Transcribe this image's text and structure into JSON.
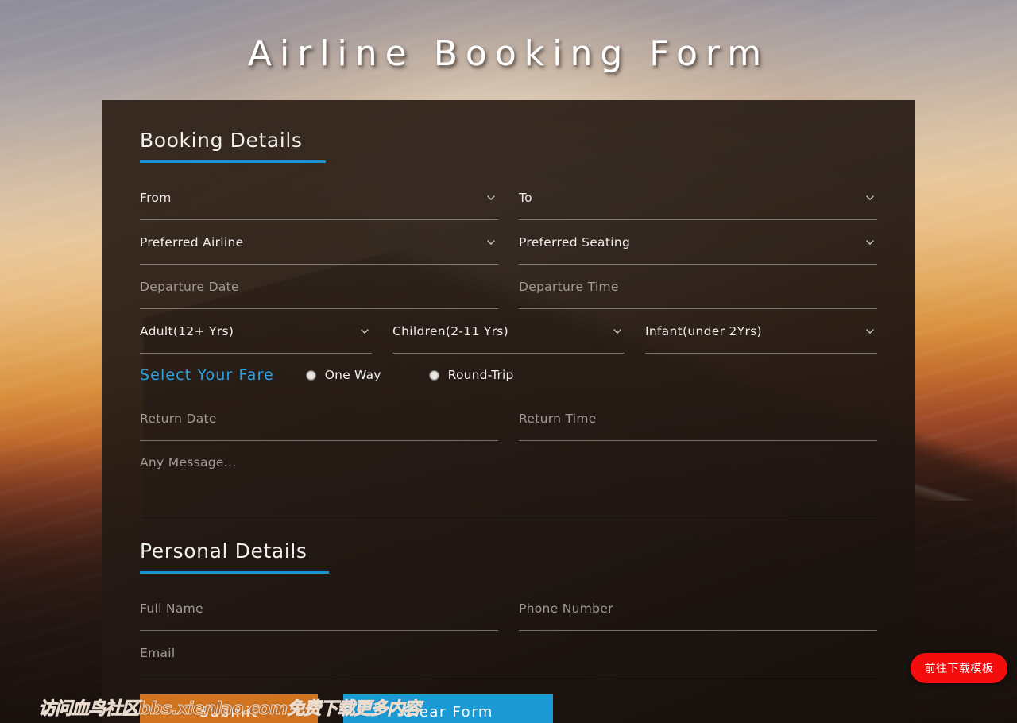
{
  "page": {
    "title": "Airline Booking Form"
  },
  "booking": {
    "heading": "Booking Details",
    "from_label": "From",
    "to_label": "To",
    "airline_label": "Preferred Airline",
    "seating_label": "Preferred Seating",
    "departure_date_placeholder": "Departure Date",
    "departure_time_placeholder": "Departure Time",
    "adult_label": "Adult(12+ Yrs)",
    "children_label": "Children(2-11 Yrs)",
    "infant_label": "Infant(under 2Yrs)",
    "fare": {
      "title": "Select Your Fare",
      "options": [
        {
          "label": "One Way",
          "selected": false
        },
        {
          "label": "Round-Trip",
          "selected": false
        }
      ]
    },
    "return_date_placeholder": "Return Date",
    "return_time_placeholder": "Return Time",
    "message_placeholder": "Any Message..."
  },
  "personal": {
    "heading": "Personal Details",
    "full_name_placeholder": "Full Name",
    "phone_placeholder": "Phone Number",
    "email_placeholder": "Email"
  },
  "actions": {
    "submit_label": "Submit",
    "clear_label": "Clear Form"
  },
  "overlays": {
    "watermark_text": "访问血鸟社区bbs.xienlao.com免费下载更多内容",
    "download_badge_label": "前往下载模板"
  },
  "colors": {
    "accent_blue": "#1b94d4",
    "fare_blue": "#2ba3e3",
    "submit_orange": "#d2741f",
    "clear_blue": "#1b9ad4",
    "badge_red": "#f50d0d",
    "panel_dark": "#1e1611"
  },
  "icons": {
    "chevron_down": "chevron-down-icon"
  }
}
